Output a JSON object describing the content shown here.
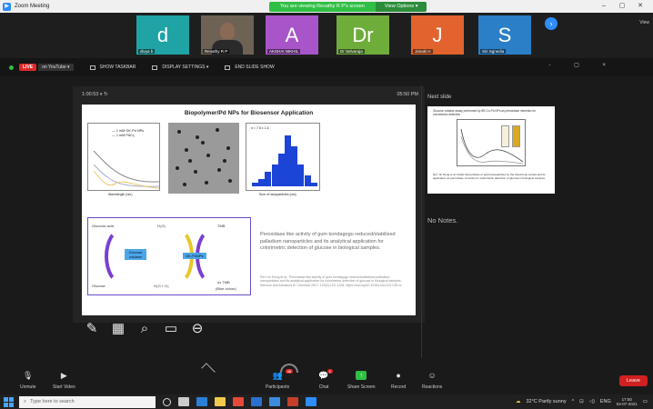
{
  "window": {
    "title": "Zoom Meeting",
    "share_banner": "You are viewing Revathy R P's screen",
    "view_options": "View Options ▾",
    "view_label": "View"
  },
  "participants": [
    {
      "letter": "d",
      "name": "divya b",
      "color": "#1fa3a5"
    },
    {
      "letter": "",
      "name": "Revathy R P",
      "color": "#6e6255"
    },
    {
      "letter": "A",
      "name": "AKSHAI NIKHIL",
      "color": "#a855c9"
    },
    {
      "letter": "Dr",
      "name": "Dr Selvaraja",
      "color": "#6fad3a"
    },
    {
      "letter": "J",
      "name": "Janaki H",
      "color": "#e2632d"
    },
    {
      "letter": "S",
      "name": "Siri Sgnedia",
      "color": "#2a7fc6"
    }
  ],
  "stagebar": {
    "live": "LIVE",
    "on_youtube": "on YouTube ▾",
    "show_taskbar": "SHOW TASKBAR",
    "display_settings": "DISPLAY SETTINGS ▾",
    "end_slide_show": "END SLIDE SHOW",
    "controls": "- ▢ ×"
  },
  "presenter": {
    "timer": "1:00:53  ⏸  ↻",
    "clock": "05:50 PM",
    "next_slide_label": "Next slide",
    "notes": "No Notes."
  },
  "slide": {
    "title": "Biopolymer/Pd NPs for Biosensor Application",
    "legend_1": "— 1 mM GK-Pd NPs",
    "legend_2": "— 1 mM PdCl₂",
    "spectrum_x": "Wavelength (nm)",
    "hist_tag": "n = 7.5 ± 1.6",
    "hist_x": "Size of nanoparticles (nm)",
    "hist_values": [
      1,
      2,
      4,
      6,
      9,
      14,
      11,
      6,
      3,
      1
    ],
    "schema_labels": {
      "gluconic": "Gluconic acid",
      "h2o2": "H₂O₂",
      "tmb": "TMB",
      "glucose": "Glucose",
      "h2o_o2": "H₂O + O₂",
      "oxtmb": "ox TMB",
      "oxtmb_sub": "(Blue colour)",
      "gox": "Glucose oxidase",
      "gkpd": "GK-PdNPs"
    },
    "caption": "Peroxidase like activity of gum kondagogu reduced/stabilized palladium nanoparticles and its analytical application for colorimetric detection of glucose in biological samples.",
    "reference": "Ref: Lin Rong et al., Peroxidase like activity of gum kondagogu reduced/stabilized palladium nanoparticles and its analytical application for colorimetric detection of glucose in biological samples. Sensors and Actuators B: Chemical 2017; 123(2):123–1234. https://doi.org/10.1016/j.snb.2017.05.xx"
  },
  "next_slide": {
    "title": "Glucose oxidase assay performed by 8R-Cn-Pd NPs as peroxidase mimetics for colorimetric detection",
    "desc": "Ref: Jin Rong et al. Facile biosynthesis of gold nanoparticles by the dried body extract and its application as peroxidase mimetics for colorimetric detection of glucose in biological samples."
  },
  "toolbar": {
    "unmute": "Unmute",
    "start_video": "Start Video",
    "participants": "Participants",
    "participants_count": "48",
    "chat": "Chat",
    "chat_badge": "1",
    "share_screen": "Share Screen",
    "record": "Record",
    "reactions": "Reactions",
    "leave": "Leave"
  },
  "taskbar": {
    "search": "Type here to search",
    "weather": "32°C  Partly sunny",
    "lang": "ENG",
    "time": "17:50",
    "date": "04-07-2021"
  }
}
